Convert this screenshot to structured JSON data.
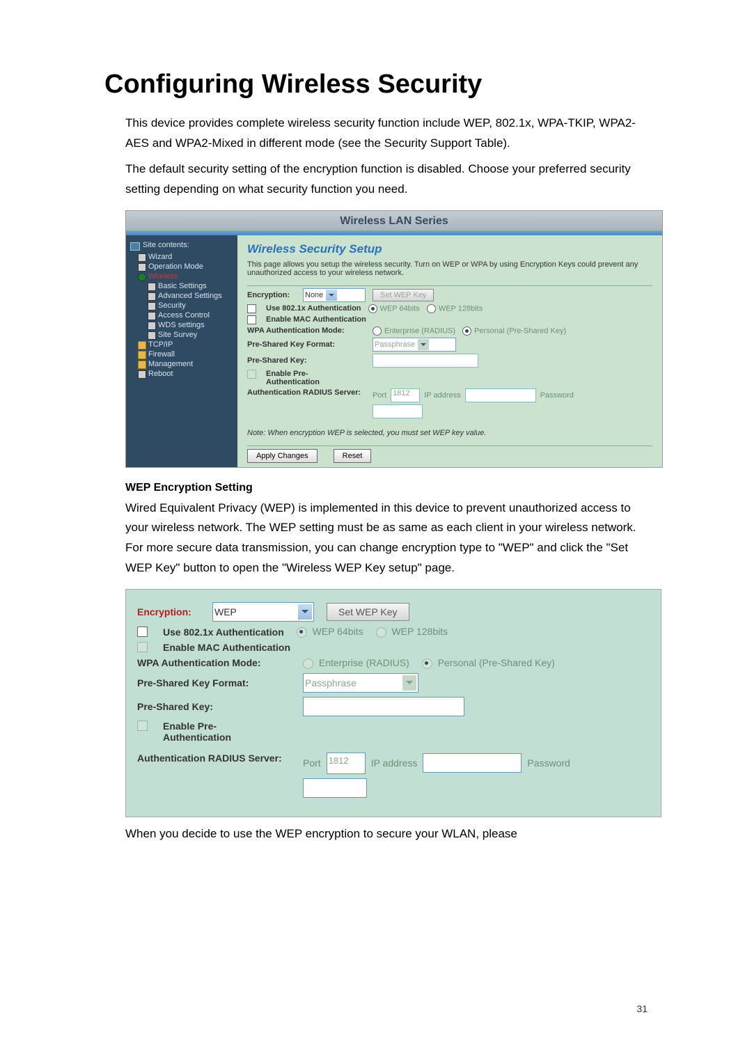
{
  "title": "Configuring Wireless Security",
  "intro1": "This device provides complete wireless security function include WEP, 802.1x, WPA-TKIP, WPA2-AES and WPA2-Mixed in different mode (see the Security Support Table).",
  "intro2": "The default security setting of the encryption function is disabled. Choose your preferred security setting depending on what security function you need.",
  "page_number": "31",
  "wep_heading": "WEP Encryption Setting",
  "wep_text": "Wired Equivalent Privacy (WEP) is implemented in this device to prevent unauthorized access to your wireless network. The WEP setting must be as same as each client in your wireless network. For more secure data transmission, you can change encryption type to \"WEP\" and click the \"Set WEP Key\" button to open the \"Wireless WEP Key setup\" page.",
  "closing": "When you decide to use the WEP encryption to secure your WLAN, please",
  "shot1": {
    "banner": "Wireless LAN Series",
    "site_contents": "Site contents:",
    "nav": [
      "Wizard",
      "Operation Mode",
      "Wireless",
      "Basic Settings",
      "Advanced Settings",
      "Security",
      "Access Control",
      "WDS settings",
      "Site Survey",
      "TCP/IP",
      "Firewall",
      "Management",
      "Reboot"
    ],
    "page_title": "Wireless Security Setup",
    "page_desc": "This page allows you setup the wireless security. Turn on WEP or WPA by using Encryption Keys could prevent any unauthorized access to your wireless network.",
    "labels": {
      "encryption": "Encryption:",
      "encryption_value": "None",
      "set_wep": "Set WEP Key",
      "use8021x": "Use 802.1x Authentication",
      "wep64": "WEP 64bits",
      "wep128": "WEP 128bits",
      "mac_auth": "Enable MAC Authentication",
      "wpa_mode": "WPA Authentication Mode:",
      "enterprise": "Enterprise (RADIUS)",
      "personal": "Personal (Pre-Shared Key)",
      "psk_format": "Pre-Shared Key Format:",
      "passphrase": "Passphrase",
      "psk": "Pre-Shared Key:",
      "pre_auth": "Enable Pre-Authentication",
      "radius": "Authentication RADIUS Server:",
      "port": "Port",
      "port_value": "1812",
      "ip": "IP address",
      "password": "Password",
      "note": "Note: When encryption WEP is selected, you must set WEP key value.",
      "apply": "Apply Changes",
      "reset": "Reset"
    }
  },
  "shot2": {
    "encryption": "Encryption:",
    "encryption_value": "WEP",
    "set_wep": "Set WEP Key",
    "use8021x": "Use 802.1x Authentication",
    "wep64": "WEP 64bits",
    "wep128": "WEP 128bits",
    "mac_auth": "Enable MAC Authentication",
    "wpa_mode": "WPA Authentication Mode:",
    "enterprise": "Enterprise (RADIUS)",
    "personal": "Personal (Pre-Shared Key)",
    "psk_format": "Pre-Shared Key Format:",
    "passphrase": "Passphrase",
    "psk": "Pre-Shared Key:",
    "pre_auth": "Enable Pre-Authentication",
    "radius": "Authentication RADIUS Server:",
    "port": "Port",
    "port_value": "1812",
    "ip": "IP address",
    "password": "Password"
  }
}
